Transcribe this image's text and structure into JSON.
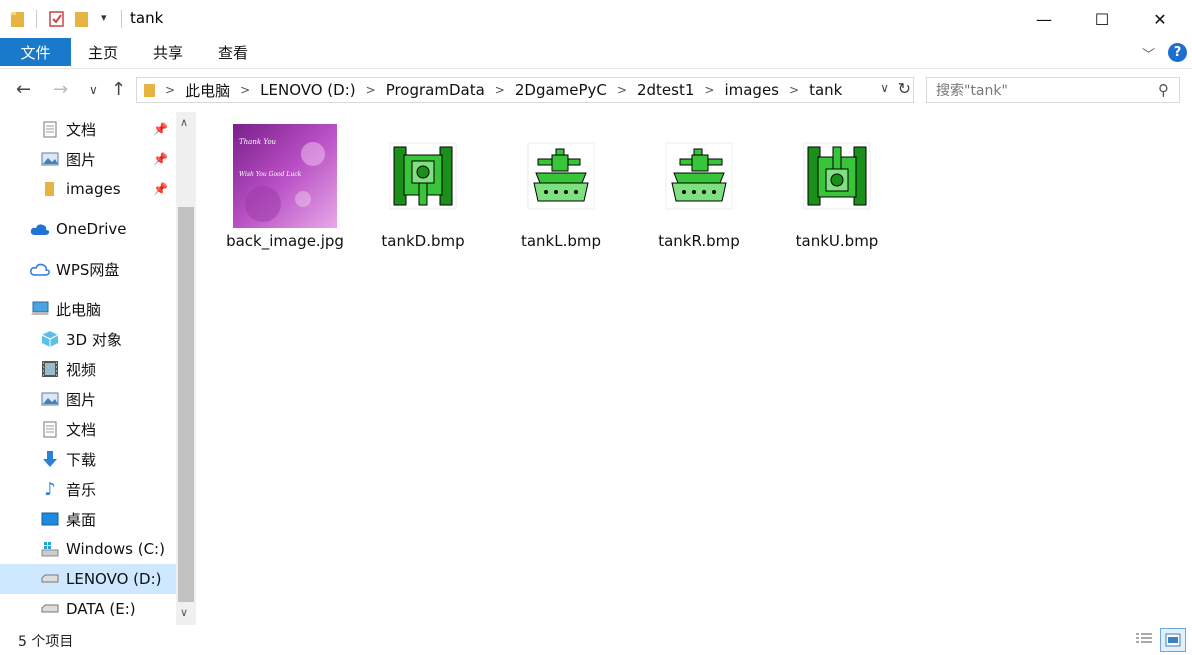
{
  "window": {
    "title": "tank",
    "minimize": "—",
    "maximize": "☐",
    "close": "✕"
  },
  "ribbon": {
    "file": "文件",
    "tabs": [
      "主页",
      "共享",
      "查看"
    ],
    "help": "?"
  },
  "address": {
    "crumbs": [
      "此电脑",
      "LENOVO (D:)",
      "ProgramData",
      "2DgamePyC",
      "2dtest1",
      "images",
      "tank"
    ],
    "separator": ">"
  },
  "search": {
    "placeholder": "搜索\"tank\""
  },
  "sidebar": {
    "items": [
      {
        "label": "文档",
        "icon": "document-icon",
        "pinned": true
      },
      {
        "label": "图片",
        "icon": "pictures-icon",
        "pinned": true
      },
      {
        "label": "images",
        "icon": "folder-icon",
        "pinned": true
      },
      {
        "label": "OneDrive",
        "icon": "cloud-icon"
      },
      {
        "label": "WPS网盘",
        "icon": "wps-cloud-icon"
      },
      {
        "label": "此电脑",
        "icon": "computer-icon"
      },
      {
        "label": "3D 对象",
        "icon": "3d-objects-icon"
      },
      {
        "label": "视频",
        "icon": "video-icon"
      },
      {
        "label": "图片",
        "icon": "pictures-icon"
      },
      {
        "label": "文档",
        "icon": "document-icon"
      },
      {
        "label": "下载",
        "icon": "download-icon"
      },
      {
        "label": "音乐",
        "icon": "music-icon"
      },
      {
        "label": "桌面",
        "icon": "desktop-icon"
      },
      {
        "label": "Windows (C:)",
        "icon": "windows-drive-icon"
      },
      {
        "label": "LENOVO (D:)",
        "icon": "drive-icon",
        "selected": true
      },
      {
        "label": "DATA (E:)",
        "icon": "drive-icon"
      }
    ]
  },
  "files": [
    {
      "name": "back_image.jpg",
      "kind": "photo",
      "thumb_text_1": "Thank You",
      "thumb_text_2": "Wish You Good Luck"
    },
    {
      "name": "tankD.bmp",
      "kind": "tank-down"
    },
    {
      "name": "tankL.bmp",
      "kind": "tank-left"
    },
    {
      "name": "tankR.bmp",
      "kind": "tank-right"
    },
    {
      "name": "tankU.bmp",
      "kind": "tank-up"
    }
  ],
  "status": {
    "count_text": "5 个项目"
  },
  "colors": {
    "accent": "#1979ca",
    "selection": "#cde8ff",
    "tank_green": "#1fa51f",
    "tank_light": "#7ee07e"
  }
}
